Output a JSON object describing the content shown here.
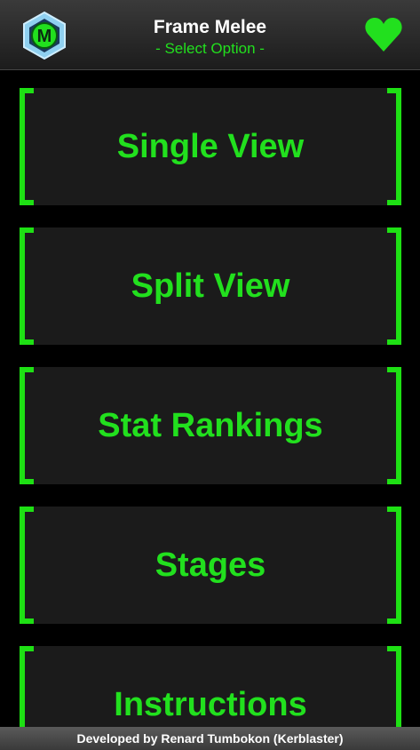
{
  "header": {
    "title": "Frame Melee",
    "subtitle": "- Select Option -",
    "logo_icon": "m-hexagon-logo-icon",
    "favorite_icon": "heart-icon"
  },
  "menu": {
    "items": [
      {
        "label": "Single View"
      },
      {
        "label": "Split View"
      },
      {
        "label": "Stat Rankings"
      },
      {
        "label": "Stages"
      },
      {
        "label": "Instructions"
      }
    ]
  },
  "footer": {
    "credit": "Developed by Renard Tumbokon (Kerblaster)"
  },
  "colors": {
    "accent": "#22e01e",
    "background": "#000000",
    "button_bg": "#1b1b1b"
  }
}
